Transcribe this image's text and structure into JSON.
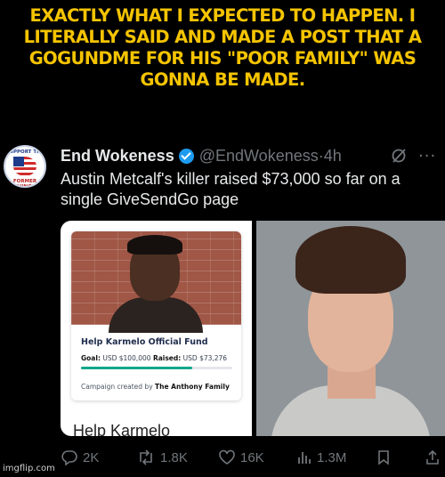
{
  "caption": {
    "lines": [
      "EXACTLY WHAT I EXPECTED TO HAPPEN. I",
      "LITERALLY SAID AND MADE A POST THAT A",
      "GOGUNDME FOR HIS \"POOR FAMILY\" WAS",
      "GONNA BE MADE."
    ],
    "color": "#f5c400"
  },
  "tweet": {
    "author_name": "End Wokeness",
    "handle": "@EndWokeness",
    "separator": "·",
    "time": "4h",
    "text": "Austin Metcalf's killer raised $73,000 so far on a single GiveSendGo page",
    "avatar_ring_top": "SUPPORT THE",
    "avatar_ring_bottom": "FORMER THINGS",
    "verified_color": "#1d9bf0",
    "icons": [
      "verified-badge-icon",
      "grok-icon",
      "more-icon"
    ]
  },
  "campaign": {
    "title": "Help Karmelo Official Fund",
    "goal_label": "Goal:",
    "goal_value": "USD $100,000",
    "raised_label": "Raised:",
    "raised_value": "USD $73,276",
    "progress_fraction": 0.73276,
    "creator_prefix": "Campaign created by",
    "creator_name": "The Anthony Family",
    "heading": "Help Karmelo",
    "accent": "#12a88a"
  },
  "actions": {
    "replies": "2K",
    "reposts": "1.8K",
    "likes": "16K",
    "views": "1.3M",
    "icons": [
      "reply-icon",
      "repost-icon",
      "like-icon",
      "views-icon",
      "bookmark-icon",
      "share-icon"
    ]
  },
  "watermark": "imgflip.com"
}
